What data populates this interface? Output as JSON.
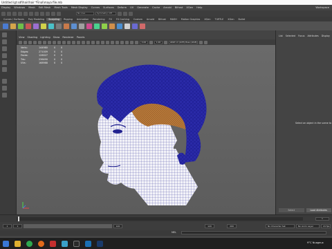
{
  "window": {
    "title": "Untitled lgt:sdf\\hair\\hair *Final\\maya file.mb"
  },
  "menubar": {
    "items": [
      "Display",
      "Windows",
      "Mesh",
      "Edit Mesh",
      "Mesh Tools",
      "Mesh Display",
      "Curves",
      "Surfaces",
      "Deform",
      "UV",
      "Generate",
      "Cache",
      "Arnold",
      "Bifrost",
      "XGen",
      "Help"
    ],
    "workspace": "Workspace"
  },
  "status_line": {
    "live_surface": "No Live Surface",
    "symmetry": "Symmetry: Off"
  },
  "shelf": {
    "tabs": [
      "Curves / Surfaces",
      "Poly Modeling",
      "Sculpting",
      "Rigging",
      "Animation",
      "Rendering",
      "FX",
      "FX Caching",
      "Custom",
      "Arnold",
      "Bifrost",
      "MASH",
      "Motion Graphics",
      "XGen",
      "TURTLE",
      "XGen",
      "Bullet"
    ],
    "active_tab": 2
  },
  "panel": {
    "menu": [
      "View",
      "Shading",
      "Lighting",
      "Show",
      "Renderer",
      "Panels"
    ],
    "near_clip": "0.00",
    "far_clip": "1.00",
    "color_space": "sRGB 1.6 (ACES) Base (sRGB)"
  },
  "heads_up": {
    "rows": [
      {
        "label": "Verts:",
        "value": "144980",
        "sel": "0",
        "comp": "0"
      },
      {
        "label": "Edges:",
        "value": "271009",
        "sel": "0",
        "comp": "0"
      },
      {
        "label": "Faces:",
        "value": "126027",
        "sel": "0",
        "comp": "0"
      },
      {
        "label": "Tris:",
        "value": "236490",
        "sel": "0",
        "comp": "0"
      },
      {
        "label": "UVs:",
        "value": "168988",
        "sel": "0",
        "comp": "0"
      }
    ]
  },
  "right_panel": {
    "tabs": [
      "List",
      "Selected",
      "Focus",
      "Attributes",
      "Display"
    ],
    "message": "Select an object in the scene to",
    "buttons": [
      "Select",
      "Load Attributes"
    ]
  },
  "time": {
    "current_frame": "1",
    "range_start": "1",
    "range_inner_start": "1",
    "range_inner_end": "120",
    "range_end": "120",
    "range_end2": "200",
    "character_set": "No Character Set",
    "anim_layer": "No Anim Layer",
    "fps": "24 fps"
  },
  "command_line": {
    "label": "MEL"
  },
  "taskbar": {
    "weather": "9°C Nuageux"
  },
  "colors": {
    "wire_blue": "#1a1a8c",
    "hair_orange": "#b8793a",
    "face_white": "#f2f2f8",
    "viewport_bg": "#646464"
  }
}
